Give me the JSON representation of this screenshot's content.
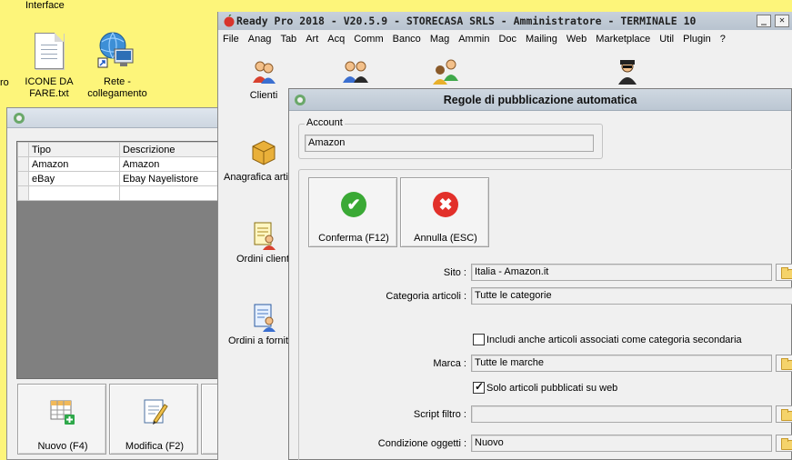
{
  "desktop": {
    "top_label": "Interface",
    "left_edge_label": "ro",
    "icons": [
      {
        "label_line1": "ICONE DA",
        "label_line2": "FARE.txt",
        "icon": "text-file-icon"
      },
      {
        "label_line1": "Rete -",
        "label_line2": "collegamento",
        "icon": "network-shortcut-icon"
      }
    ]
  },
  "back_window": {
    "grid": {
      "headers": [
        "Tipo",
        "Descrizione"
      ],
      "rows": [
        {
          "tipo": "Amazon",
          "descrizione": "Amazon"
        },
        {
          "tipo": "eBay",
          "descrizione": "Ebay Nayelistore"
        }
      ]
    },
    "buttons": {
      "nuovo": "Nuovo (F4)",
      "modifica": "Modifica (F2)"
    }
  },
  "main_window": {
    "title": "Ready Pro 2018 - V20.5.9 - STORECASA SRLS - Amministratore - TERMINALE 10",
    "minimize_glyph": "_",
    "close_glyph": "✕",
    "menu": [
      "File",
      "Anag",
      "Tab",
      "Art",
      "Acq",
      "Comm",
      "Banco",
      "Mag",
      "Ammin",
      "Doc",
      "Mailing",
      "Web",
      "Marketplace",
      "Util",
      "Plugin",
      "?"
    ],
    "sidebar": [
      {
        "label": "Clienti",
        "icon": "clients-icon"
      },
      {
        "label": "Anagrafica arti",
        "icon": "products-box-icon"
      },
      {
        "label": "Ordini client",
        "icon": "customer-orders-icon"
      },
      {
        "label": "Ordini a fornit",
        "icon": "supplier-orders-icon"
      }
    ]
  },
  "dialog": {
    "title": "Regole di pubblicazione automatica",
    "account_legend": "Account",
    "account_value": "Amazon",
    "confirm_label": "Conferma (F12)",
    "cancel_label": "Annulla (ESC)",
    "confirm_glyph": "✔",
    "cancel_glyph": "✖",
    "fields": {
      "sito_label": "Sito :",
      "sito_value": "Italia - Amazon.it",
      "categoria_label": "Categoria articoli :",
      "categoria_value": "Tutte le categorie",
      "includi_label": "Includi anche articoli associati come categoria secondaria",
      "includi_checked": false,
      "marca_label": "Marca :",
      "marca_value": "Tutte le marche",
      "solo_label": "Solo articoli pubblicati su web",
      "solo_checked": true,
      "script_label": "Script filtro :",
      "script_value": "",
      "condizione_label": "Condizione oggetti :",
      "condizione_value": "Nuovo"
    }
  },
  "colors": {
    "desktop_bg": "#fdf57a",
    "confirm_green": "#3aa935",
    "cancel_red": "#e2302a"
  }
}
